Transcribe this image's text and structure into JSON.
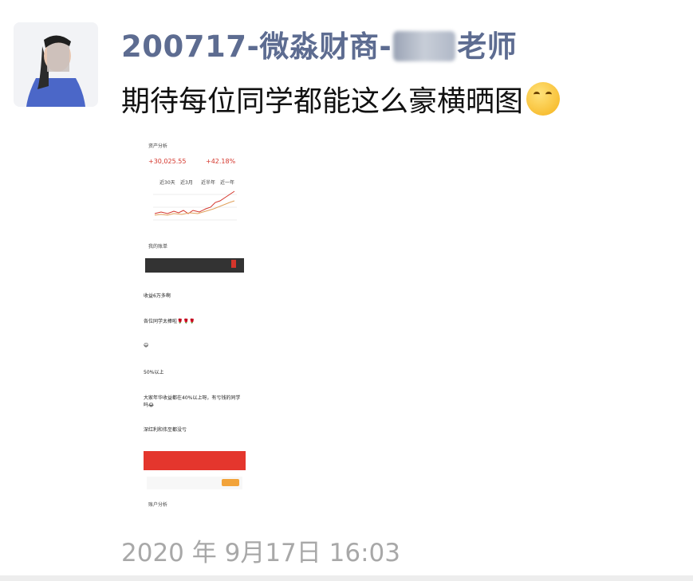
{
  "post": {
    "name_prefix": "200717-微淼财商-",
    "name_suffix": "老师",
    "message": "期待每位同学都能这么豪横晒图",
    "timestamp": "2020 年 9月17日 16:03"
  },
  "screenshot": {
    "header_left": "资产分析",
    "gain": "+30,025.55",
    "gain_pct": "+42.18%",
    "tabs": [
      "近30天",
      "近3月",
      "近半年",
      "近一年"
    ],
    "section": "我的账单",
    "chat": [
      {
        "text": "收益6万多啊"
      },
      {
        "text": "各位同学太棒啦🌹🌹🌹"
      },
      {
        "text": "😄"
      },
      {
        "text": "50%以上"
      },
      {
        "text": "大家年华收益都在40%以上呀，有亏钱的同学吗😂"
      },
      {
        "text": "深红利和伟至都没亏"
      }
    ],
    "bottom_title": "账户分析"
  },
  "colors": {
    "name": "#5d6c91",
    "accent_red": "#d4352b"
  }
}
